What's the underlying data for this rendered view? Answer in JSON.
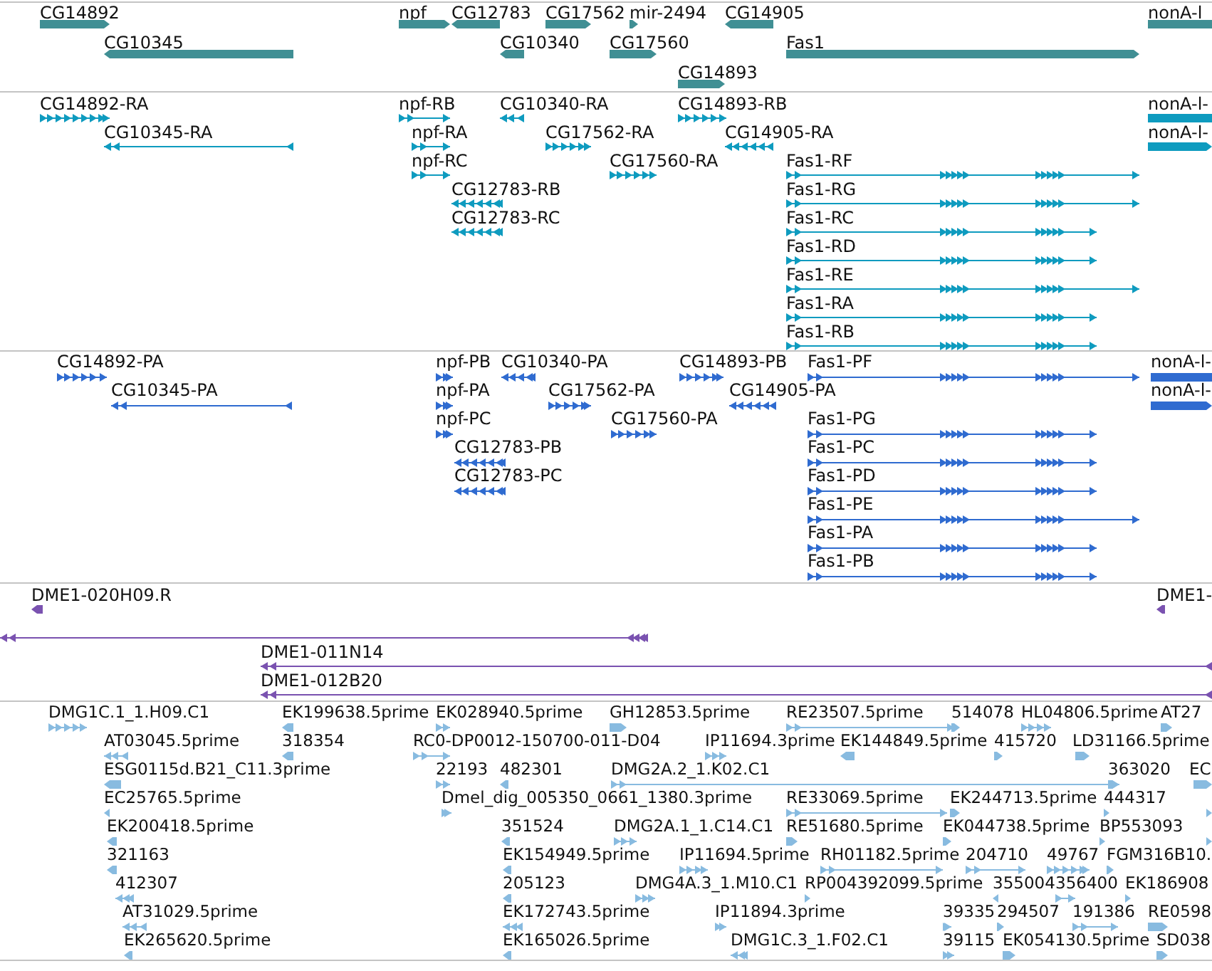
{
  "tracks": [
    {
      "kind": "gene",
      "features": [
        {
          "label": "CG14892",
          "reverse": false
        },
        {
          "label": "npf",
          "reverse": false
        },
        {
          "label": "CG12783",
          "reverse": true
        },
        {
          "label": "CG17562",
          "reverse": false
        },
        {
          "label": "mir-2494",
          "reverse": false
        },
        {
          "label": "CG14905",
          "reverse": true
        },
        {
          "label": "nonA-l"
        },
        {
          "label": "CG10345",
          "reverse": true
        },
        {
          "label": "CG10340",
          "reverse": true
        },
        {
          "label": "CG17560",
          "reverse": false
        },
        {
          "label": "Fas1",
          "reverse": false
        },
        {
          "label": "CG14893",
          "reverse": false
        }
      ]
    },
    {
      "kind": "transcript",
      "features": [
        {
          "label": "CG14892-RA",
          "reverse": false
        },
        {
          "label": "CG10345-RA",
          "reverse": true
        },
        {
          "label": "npf-RB",
          "reverse": false
        },
        {
          "label": "npf-RA",
          "reverse": false
        },
        {
          "label": "npf-RC",
          "reverse": false
        },
        {
          "label": "CG12783-RB",
          "reverse": true
        },
        {
          "label": "CG12783-RC",
          "reverse": true
        },
        {
          "label": "CG10340-RA",
          "reverse": true
        },
        {
          "label": "CG17562-RA",
          "reverse": false
        },
        {
          "label": "CG14893-RB",
          "reverse": false
        },
        {
          "label": "CG14905-RA",
          "reverse": true
        },
        {
          "label": "CG17560-RA",
          "reverse": false
        },
        {
          "label": "Fas1-RF",
          "reverse": false
        },
        {
          "label": "Fas1-RG",
          "reverse": false
        },
        {
          "label": "Fas1-RC",
          "reverse": false
        },
        {
          "label": "Fas1-RD",
          "reverse": false
        },
        {
          "label": "Fas1-RE",
          "reverse": false
        },
        {
          "label": "Fas1-RA",
          "reverse": false
        },
        {
          "label": "Fas1-RB",
          "reverse": false
        },
        {
          "label": "nonA-l-"
        },
        {
          "label": "nonA-l-",
          "reverse": false
        }
      ]
    },
    {
      "kind": "protein",
      "features": [
        {
          "label": "CG14892-PA",
          "reverse": false
        },
        {
          "label": "CG10345-PA",
          "reverse": true
        },
        {
          "label": "npf-PB",
          "reverse": false
        },
        {
          "label": "npf-PA",
          "reverse": false
        },
        {
          "label": "npf-PC",
          "reverse": false
        },
        {
          "label": "CG12783-PB",
          "reverse": true
        },
        {
          "label": "CG12783-PC",
          "reverse": true
        },
        {
          "label": "CG10340-PA",
          "reverse": true
        },
        {
          "label": "CG17562-PA",
          "reverse": false
        },
        {
          "label": "CG14893-PB",
          "reverse": false
        },
        {
          "label": "CG14905-PA",
          "reverse": true
        },
        {
          "label": "CG17560-PA",
          "reverse": false
        },
        {
          "label": "Fas1-PF",
          "reverse": false
        },
        {
          "label": "Fas1-PG",
          "reverse": false
        },
        {
          "label": "Fas1-PC",
          "reverse": false
        },
        {
          "label": "Fas1-PD",
          "reverse": false
        },
        {
          "label": "Fas1-PE",
          "reverse": false
        },
        {
          "label": "Fas1-PA",
          "reverse": false
        },
        {
          "label": "Fas1-PB",
          "reverse": false
        },
        {
          "label": "nonA-l-"
        },
        {
          "label": "nonA-l-",
          "reverse": false
        }
      ]
    },
    {
      "kind": "clone",
      "features": [
        {
          "label": "DME1-020H09.R",
          "reverse": true
        },
        {
          "label": "DME1-",
          "reverse": true
        },
        {
          "reverse": true
        },
        {
          "label": "DME1-011N14",
          "reverse": true
        },
        {
          "label": "DME1-012B20",
          "reverse": true
        }
      ]
    },
    {
      "kind": "est",
      "features": [
        {
          "label": "DMG1C.1_1.H09.C1",
          "reverse": false
        },
        {
          "label": "EK199638.5prime",
          "reverse": true
        },
        {
          "label": "EK028940.5prime",
          "reverse": false
        },
        {
          "label": "GH12853.5prime",
          "reverse": false
        },
        {
          "label": "RE23507.5prime",
          "reverse": false
        },
        {
          "label": "514078",
          "reverse": false
        },
        {
          "label": "HL04806.5prime",
          "reverse": false
        },
        {
          "label": "AT27",
          "reverse": false
        },
        {
          "label": "AT03045.5prime",
          "reverse": true
        },
        {
          "label": "318354",
          "reverse": true
        },
        {
          "label": "RC0-DP0012-150700-011-D04",
          "reverse": false
        },
        {
          "label": "IP11694.3prime",
          "reverse": false
        },
        {
          "label": "EK144849.5prime",
          "reverse": true
        },
        {
          "label": "415720",
          "reverse": false
        },
        {
          "label": "LD31166.5prime",
          "reverse": false
        },
        {
          "label": "ESG0115d.B21_C11.3prime",
          "reverse": true
        },
        {
          "label": "22193",
          "reverse": false
        },
        {
          "label": "482301",
          "reverse": true
        },
        {
          "label": "DMG2A.2_1.K02.C1",
          "reverse": false
        },
        {
          "label": "363020",
          "reverse": false
        },
        {
          "label": "EC",
          "reverse": false
        },
        {
          "label": "EC25765.5prime",
          "reverse": true
        },
        {
          "label": "Dmel_dig_005350_0661_1380.3prime",
          "reverse": false
        },
        {
          "label": "RE33069.5prime",
          "reverse": false
        },
        {
          "label": "EK244713.5prime",
          "reverse": false
        },
        {
          "label": "444317",
          "reverse": false
        },
        {
          "reverse": false
        },
        {
          "label": "EK200418.5prime",
          "reverse": true
        },
        {
          "label": "351524",
          "reverse": true
        },
        {
          "label": "DMG2A.1_1.C14.C1",
          "reverse": false
        },
        {
          "label": "RE51680.5prime",
          "reverse": false
        },
        {
          "label": "EK044738.5prime",
          "reverse": false
        },
        {
          "label": "BP553093",
          "reverse": false
        },
        {
          "reverse": false
        },
        {
          "label": "321163",
          "reverse": true
        },
        {
          "label": "EK154949.5prime",
          "reverse": true
        },
        {
          "label": "IP11694.5prime",
          "reverse": false
        },
        {
          "label": "RH01182.5prime",
          "reverse": false
        },
        {
          "label": "204710",
          "reverse": false
        },
        {
          "label": "49767",
          "reverse": false
        },
        {
          "label": "FGM316B10.",
          "reverse": false
        },
        {
          "label": "412307",
          "reverse": true
        },
        {
          "label": "205123",
          "reverse": true
        },
        {
          "label": "DMG4A.3_1.M10.C1",
          "reverse": false
        },
        {
          "label": "RP004392099.5prime",
          "reverse": false
        },
        {
          "label": "355004",
          "reverse": true
        },
        {
          "label": "356400",
          "reverse": false
        },
        {
          "label": "EK186908",
          "reverse": false
        },
        {
          "label": "AT31029.5prime",
          "reverse": true
        },
        {
          "label": "EK172743.5prime",
          "reverse": true
        },
        {
          "label": "IP11894.3prime",
          "reverse": false
        },
        {
          "label": "39335",
          "reverse": false
        },
        {
          "label": "294507",
          "reverse": false
        },
        {
          "label": "191386",
          "reverse": false
        },
        {
          "label": "RE0598",
          "reverse": false
        },
        {
          "label": "EK265620.5prime",
          "reverse": true
        },
        {
          "label": "EK165026.5prime",
          "reverse": true
        },
        {
          "label": "DMG1C.3_1.F02.C1",
          "reverse": true
        },
        {
          "label": "39115",
          "reverse": false
        },
        {
          "label": "EK054130.5prime",
          "reverse": false
        },
        {
          "label": "SD038",
          "reverse": false
        }
      ]
    }
  ]
}
